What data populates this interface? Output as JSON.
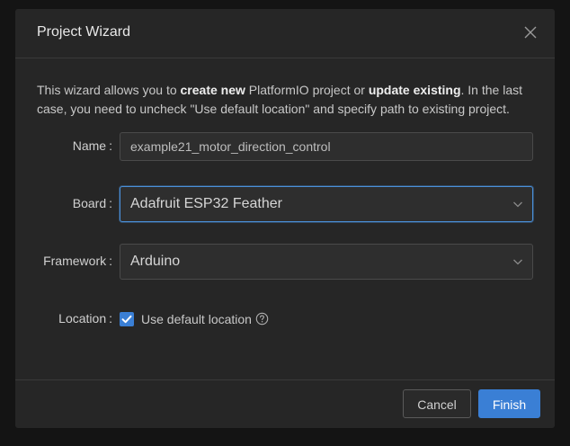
{
  "dialog": {
    "title": "Project Wizard"
  },
  "intro": {
    "part1": "This wizard allows you to ",
    "bold1": "create new",
    "part2": " PlatformIO project or ",
    "bold2": "update existing",
    "part3": ". In the last case, you need to uncheck \"Use default location\" and specify path to existing project."
  },
  "form": {
    "name_label": "Name",
    "name_value": "example21_motor_direction_control",
    "board_label": "Board",
    "board_value": "Adafruit ESP32 Feather",
    "framework_label": "Framework",
    "framework_value": "Arduino",
    "location_label": "Location",
    "use_default_location_label": "Use default location",
    "use_default_location_checked": true,
    "colon": ":"
  },
  "footer": {
    "cancel_label": "Cancel",
    "finish_label": "Finish"
  },
  "colors": {
    "accent": "#3a7fd5",
    "dialog_bg": "#262626",
    "backdrop": "#141414"
  },
  "icons": {
    "close": "close-icon",
    "dropdown": "chevron-down-icon",
    "check": "check-icon",
    "help": "question-circle-icon"
  }
}
